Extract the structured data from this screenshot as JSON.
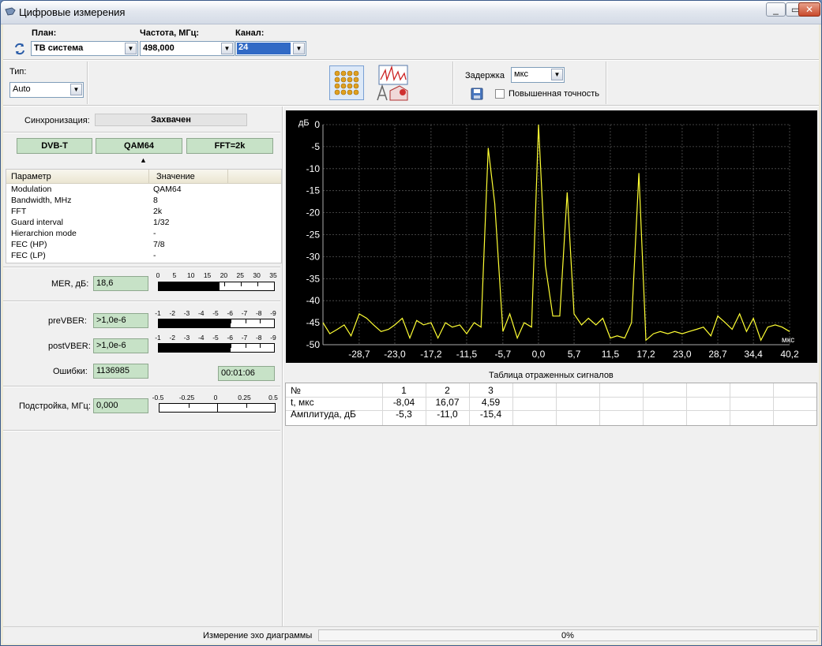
{
  "window": {
    "title": "Цифровые измерения"
  },
  "toolbar": {
    "plan_label": "План:",
    "plan_value": "ТВ система",
    "freq_label": "Частота, МГц:",
    "freq_value": "498,000",
    "channel_label": "Канал:",
    "channel_value": "24",
    "type_label": "Тип:",
    "type_value": "Auto",
    "delay_label": "Задержка",
    "delay_unit": "мкс",
    "precision_label": "Повышенная точность"
  },
  "sync": {
    "label": "Синхронизация:",
    "value": "Захвачен"
  },
  "modes": [
    "DVB-T",
    "QAM64",
    "FFT=2k"
  ],
  "params": {
    "headers": [
      "Параметр",
      "Значение"
    ],
    "rows": [
      [
        "Modulation",
        "QAM64"
      ],
      [
        "Bandwidth, MHz",
        "8"
      ],
      [
        "FFT",
        "2k"
      ],
      [
        "Guard interval",
        "1/32"
      ],
      [
        "Hierarchion mode",
        "-"
      ],
      [
        "FEC (HP)",
        "7/8"
      ],
      [
        "FEC (LP)",
        "-"
      ]
    ]
  },
  "mer": {
    "label": "MER, дБ:",
    "value": "18,6",
    "ticks": [
      "0",
      "5",
      "10",
      "15",
      "20",
      "25",
      "30",
      "35"
    ],
    "level_fraction": 0.53
  },
  "ber": {
    "ticks": [
      "-1",
      "-2",
      "-3",
      "-4",
      "-5",
      "-6",
      "-7",
      "-8",
      "-9"
    ],
    "pre_label": "preVBER:",
    "pre_value": ">1,0e-6",
    "pre_fraction": 0.625,
    "post_label": "postVBER:",
    "post_value": ">1,0e-6",
    "post_fraction": 0.625,
    "errors_label": "Ошибки:",
    "errors_value": "1136985",
    "time_value": "00:01:06"
  },
  "tuning": {
    "label": "Подстройка, МГц:",
    "value": "0,000",
    "ticks": [
      "-0.5",
      "-0.25",
      "0",
      "0.25",
      "0.5"
    ]
  },
  "chart_data": {
    "type": "line",
    "ylabel": "дБ",
    "xlabel": "мкс",
    "ylim": [
      -50,
      0
    ],
    "xlim": [
      -34.5,
      40.2
    ],
    "yticks": [
      "0",
      "-5",
      "-10",
      "-15",
      "-20",
      "-25",
      "-30",
      "-35",
      "-40",
      "-45",
      "-50"
    ],
    "xticks": [
      "-28,7",
      "-23,0",
      "-17,2",
      "-11,5",
      "-5,7",
      "0,0",
      "5,7",
      "11,5",
      "17,2",
      "23,0",
      "28,7",
      "34,4",
      "40,2"
    ],
    "grid": true,
    "color": "#ffff33",
    "x": [
      -34.5,
      -33.4,
      -32.2,
      -31.1,
      -30,
      -28.7,
      -27.5,
      -26.4,
      -25.2,
      -24,
      -23,
      -21.8,
      -20.6,
      -19.5,
      -18.4,
      -17.2,
      -16.1,
      -14.9,
      -13.8,
      -12.6,
      -11.5,
      -10.3,
      -9.2,
      -8.04,
      -7.0,
      -5.7,
      -4.6,
      -3.4,
      -2.3,
      -1.1,
      0,
      1.1,
      2.3,
      3.4,
      4.59,
      5.7,
      6.9,
      8.0,
      9.2,
      10.3,
      11.5,
      12.6,
      13.8,
      14.9,
      16.07,
      17.2,
      18.4,
      19.5,
      20.7,
      21.8,
      23,
      24.1,
      25.3,
      26.4,
      27.6,
      28.7,
      29.9,
      31,
      32.2,
      33.3,
      34.4,
      35.6,
      36.7,
      37.9,
      39,
      40.2
    ],
    "y": [
      -45,
      -47.5,
      -46.5,
      -45.5,
      -48,
      -43,
      -44,
      -45.5,
      -47,
      -46.5,
      -45.5,
      -44,
      -48.5,
      -44.5,
      -45.5,
      -45,
      -48.5,
      -45,
      -46,
      -45.5,
      -47.5,
      -45,
      -46,
      -5.3,
      -18,
      -47,
      -43,
      -48.5,
      -45,
      -46,
      0,
      -32,
      -43.5,
      -43.5,
      -15.4,
      -43,
      -45.5,
      -44,
      -45.5,
      -44,
      -48.5,
      -48,
      -48.5,
      -45,
      -11.0,
      -49,
      -47.5,
      -47,
      -47.5,
      -47,
      -47.5,
      -47,
      -46.5,
      -46,
      -48,
      -43.5,
      -45,
      -46.5,
      -43,
      -47,
      -44,
      -49,
      -46,
      -45.5,
      -46,
      -47
    ]
  },
  "reflections": {
    "title": "Таблица отраженных сигналов",
    "row_labels": [
      "№",
      "t, мкс",
      "Амплитуда, дБ"
    ],
    "cols": [
      [
        "1",
        "-8,04",
        "-5,3"
      ],
      [
        "2",
        "16,07",
        "-11,0"
      ],
      [
        "3",
        "4,59",
        "-15,4"
      ]
    ]
  },
  "status": {
    "label": "Измерение эхо диаграммы",
    "progress": "0%",
    "progress_fraction": 0
  }
}
